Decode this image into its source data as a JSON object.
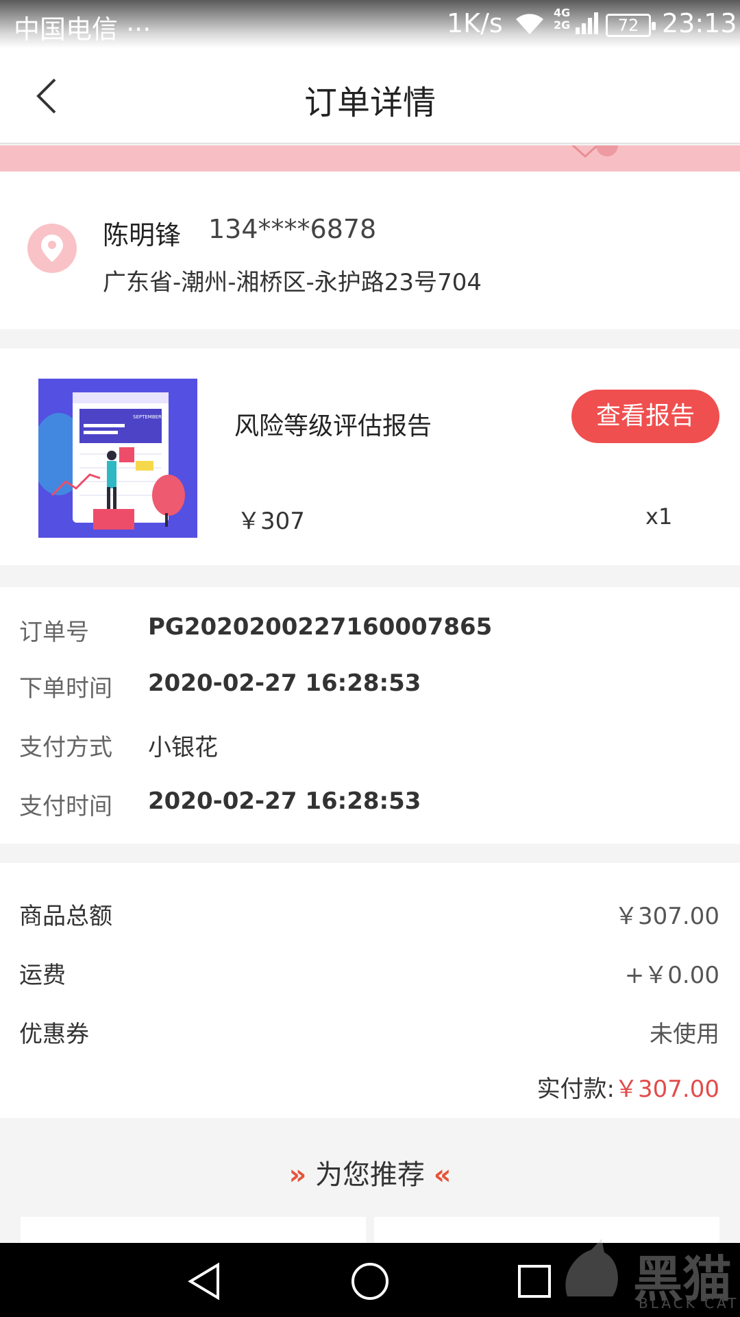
{
  "status_bar": {
    "carrier": "中国电信 ···",
    "speed": "1K/s",
    "network": "4G\n2G",
    "battery": "72",
    "time": "23:13"
  },
  "header": {
    "title": "订单详情"
  },
  "address": {
    "name": "陈明锋",
    "phone": "134****6878",
    "detail": "广东省-潮州-湘桥区-永护路23号704"
  },
  "product": {
    "name": "风险等级评估报告",
    "button_label": "查看报告",
    "price": "￥307",
    "quantity": "x1",
    "thumb_word": "SEPTEMBER"
  },
  "order_info": {
    "rows": [
      {
        "label": "订单号",
        "value": "PG2020200227160007865"
      },
      {
        "label": "下单时间",
        "value": "2020-02-27 16:28:53"
      },
      {
        "label": "支付方式",
        "value": "小银花"
      },
      {
        "label": "支付时间",
        "value": "2020-02-27 16:28:53"
      }
    ]
  },
  "amounts": {
    "rows": [
      {
        "label": "商品总额",
        "value": "￥307.00"
      },
      {
        "label": "运费",
        "value": "+￥0.00"
      },
      {
        "label": "优惠券",
        "value": "未使用"
      }
    ],
    "paid_label": "实付款:",
    "paid_value": "￥307.00"
  },
  "recommend": {
    "title": "为您推荐",
    "left_chevron": "»",
    "right_chevron": "«"
  },
  "watermark": {
    "text": "黑猫",
    "sub": "BLACK CAT"
  },
  "colors": {
    "accent": "#f04f4f",
    "price_red": "#e24b4b",
    "pink_strip": "#f7bfc3"
  },
  "icons": [
    "back-arrow-icon",
    "location-pin-icon",
    "wifi-icon",
    "signal-icon",
    "nav-back-icon",
    "nav-home-icon",
    "nav-recents-icon"
  ]
}
